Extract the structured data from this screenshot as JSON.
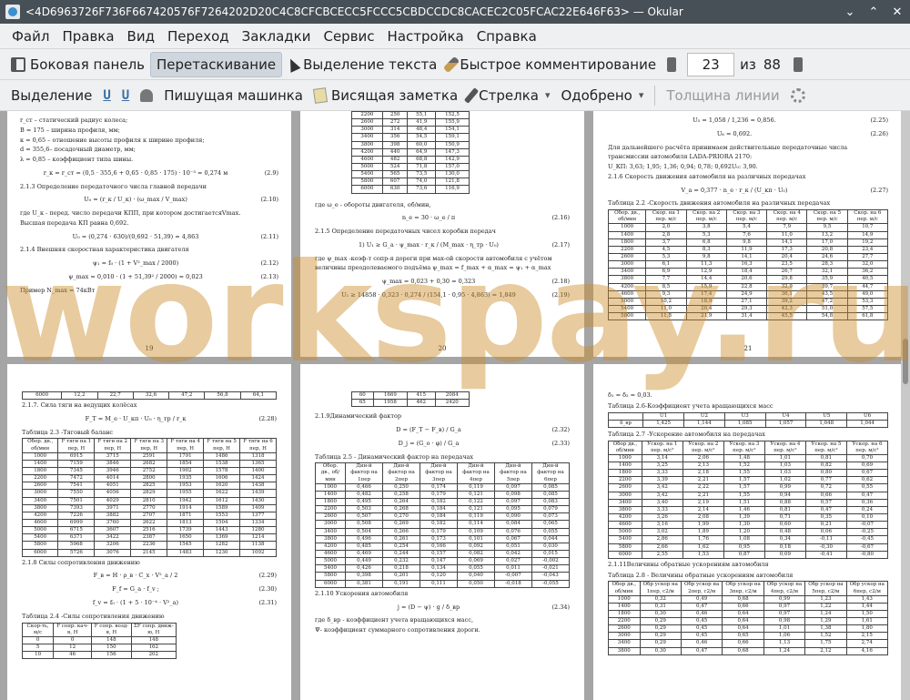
{
  "window": {
    "title": "<4D6963726F736F667420576F7264202D20C4C8CFCBCECC5FCCC5CBDCCDC8CACEC2C05FCAC22E646F63> — Okular",
    "controls": [
      "⌄",
      "⌃",
      "✕"
    ]
  },
  "menubar": [
    "Файл",
    "Правка",
    "Вид",
    "Переход",
    "Закладки",
    "Сервис",
    "Настройка",
    "Справка"
  ],
  "toolbar1": {
    "sidebar": "Боковая панель",
    "drag": "Перетаскивание",
    "select_text": "Выделение текста",
    "quick_comment": "Быстрое комментирование",
    "page_current": "23",
    "page_of": "из",
    "page_total": "88"
  },
  "toolbar2": {
    "highlight": "Выделение",
    "typewriter": "Пишущая машинка",
    "note": "Висящая заметка",
    "arrow": "Стрелка",
    "approved": "Одобрено",
    "line_width": "Толщина линии"
  },
  "watermark": "workspay.ru",
  "pages": {
    "p19": {
      "number": "19",
      "lines": [
        "r_ст – статический радиус колеса;",
        "B = 175 – ширина профиля, мм;",
        "κ = 0,65 – отношение высоты профиля к ширине профиля;",
        "d = 355,6– посадочный диаметр, мм;",
        "λ = 0,85 – коэффициент типа шины."
      ],
      "eq1": "r_к = r_ст = (0,5 · 355,6 + 0,65 · 0,85 · 175) · 10⁻³ = 0,274 м",
      "eq1n": "(2.9)",
      "h213": "2.1.3 Определение передаточного числа главной передачи",
      "eq2": "U₀ = (r_к / U_к) · (ω_max / V_max)",
      "eq2n": "(2.10)",
      "l2": "где U_к - перед. число передачи КПП, при котором достигаетсяVmax.",
      "l3": "Высшая передача КП равна 0,692.",
      "eq3": "U₀ = (0,274 · 630)/(0,692 · 51,39) = 4,863",
      "eq3n": "(2.11)",
      "h214": "2.1.4 Внешняя скоростная характеристика двигателя",
      "eq4": "ψ₁ = f₀ · (1 + V²_max / 2000)",
      "eq4n": "(2.12)",
      "eq5": "ψ_max = 0,010 · (1 + 51,39² / 2000) = 0,023",
      "eq5n": "(2.13)",
      "l4": "Пример  N_max = 74кВт"
    },
    "p20": {
      "number": "20",
      "table": [
        [
          "2200",
          "250",
          "55,1",
          "152,5"
        ],
        [
          "2600",
          "272",
          "41,9",
          "155,9"
        ],
        [
          "3000",
          "314",
          "48,4",
          "154,1"
        ],
        [
          "3400",
          "356",
          "54,5",
          "159,1"
        ],
        [
          "3800",
          "398",
          "60,0",
          "150,9"
        ],
        [
          "4200",
          "440",
          "64,9",
          "147,3"
        ],
        [
          "4600",
          "482",
          "68,8",
          "142,9"
        ],
        [
          "5000",
          "524",
          "71,8",
          "157,0"
        ],
        [
          "5400",
          "565",
          "73,5",
          "130,0"
        ],
        [
          "5800",
          "607",
          "74,0",
          "121,8"
        ],
        [
          "6000",
          "630",
          "73,6",
          "116,9"
        ]
      ],
      "l1": "где ω_e - обороты двигателя, об/мин,",
      "eq1": "n_e = 30 · ω_e / π",
      "eq1n": "(2.16)",
      "h215": "2.1.5 Определение передаточных чисел коробки передач",
      "eq2": "1) U₁ ≥ G_a · ψ_max · r_к / (M_max · η_тр · U₀)",
      "eq2n": "(2.17)",
      "l2": "где ψ_max -коэф-т сопр-я дороги при мах-ой скорости автомобиля  с учётом",
      "l3": "величины преодолеваемого подъёма ψ_max = f_max + α_max = ψ₁ + α_max",
      "eq3": "ψ_max = 0,023 + 0,30 = 0,323",
      "eq3n": "(2.18)",
      "eq4": "U₁ ≥ 14858 · 0,323 · 0,274 / (154,1 · 0,95 · 4,863) = 1,849",
      "eq4n": "(2.19)"
    },
    "p21": {
      "number": "21",
      "eq1": "U₅ = 1,058 / 1,236 = 0,856.",
      "eq1n": "(2.25)",
      "eq2": "U₆ = 0,692.",
      "eq2n": "(2.26)",
      "l1": "Для дальнейшего расчёта принимаем действительные передаточные числа",
      "l2": "трансмиссии автомобиля LADA-PRIORA 2170:",
      "l3": "U_КП: 3,63; 1,95; 1,36; 0,94; 0,78; 0,692U₀: 3,90.",
      "h216": "2.1.6 Скорость движения автомобиля на различных передачах",
      "eq3": "V_a = 0,377 · n_e · r_к / (U_кп · U₀)",
      "eq3n": "(2.27)",
      "cap": "Таблица 2.2 -Скорость движения автомобиля на различных передачах",
      "headers": [
        "Обор. дв., об/мин",
        "Скор. на 1 пер. м/с",
        "Скор. на 2 пер. м/с",
        "Скор. на 3 пер. м/с",
        "Скор. на 4 пер. м/с",
        "Скор. на 5 пер. м/с",
        "Скор. на 6 пер. м/с"
      ],
      "rows": [
        [
          "1000",
          "2,0",
          "3,8",
          "5,4",
          "7,9",
          "9,5",
          "10,7"
        ],
        [
          "1400",
          "2,8",
          "5,3",
          "7,6",
          "11,0",
          "13,2",
          "14,9"
        ],
        [
          "1800",
          "3,7",
          "6,8",
          "9,8",
          "14,1",
          "17,0",
          "19,2"
        ],
        [
          "2200",
          "4,5",
          "8,3",
          "11,9",
          "17,3",
          "20,8",
          "23,4"
        ],
        [
          "2600",
          "5,3",
          "9,8",
          "14,1",
          "20,4",
          "24,6",
          "27,7"
        ],
        [
          "3000",
          "6,1",
          "11,3",
          "16,3",
          "23,5",
          "28,3",
          "32,0"
        ],
        [
          "3400",
          "6,9",
          "12,9",
          "18,4",
          "26,7",
          "32,1",
          "36,2"
        ],
        [
          "3800",
          "7,7",
          "14,4",
          "20,6",
          "29,8",
          "35,9",
          "40,5"
        ],
        [
          "4200",
          "8,5",
          "15,9",
          "22,8",
          "32,9",
          "39,7",
          "44,7"
        ],
        [
          "4600",
          "9,3",
          "17,4",
          "24,9",
          "36,1",
          "43,5",
          "49,0"
        ],
        [
          "5000",
          "10,2",
          "18,9",
          "27,1",
          "39,2",
          "47,2",
          "53,3"
        ],
        [
          "5400",
          "11,0",
          "20,4",
          "29,3",
          "42,3",
          "51,0",
          "57,5"
        ],
        [
          "5800",
          "11,8",
          "21,9",
          "31,4",
          "45,5",
          "54,8",
          "61,8"
        ]
      ]
    },
    "p22": {
      "first_row": [
        "6000",
        "12,2",
        "22,7",
        "32,6",
        "47,2",
        "56,8",
        "64,1"
      ],
      "h217": "2.1.7. Сила тяги на ведущих колёсах",
      "eq1": "F_T = M_e · U_кп · U₀ · η_тр / r_к",
      "eq1n": "(2.28)",
      "cap": "Таблица 2.3 -Тяговый баланс",
      "headers": [
        "Обор. дв., об/мин",
        "F тяги на 1 пер, Н",
        "F тяги на 2 пер, Н",
        "F тяги на 3 пер, Н",
        "F тяги на 4 пер, Н",
        "F тяги на 5 пер, Н",
        "F тяги на 6 пер, Н"
      ],
      "rows": [
        [
          "1000",
          "6915",
          "3715",
          "2591",
          "1791",
          "1486",
          "1318"
        ],
        [
          "1400",
          "7159",
          "3846",
          "2682",
          "1854",
          "1538",
          "1365"
        ],
        [
          "1800",
          "7345",
          "3946",
          "2752",
          "1902",
          "1578",
          "1400"
        ],
        [
          "2200",
          "7472",
          "4014",
          "2800",
          "1935",
          "1606",
          "1424"
        ],
        [
          "2600",
          "7541",
          "4051",
          "2825",
          "1953",
          "1620",
          "1438"
        ],
        [
          "3000",
          "7550",
          "4056",
          "2829",
          "1955",
          "1622",
          "1439"
        ],
        [
          "3400",
          "7501",
          "4029",
          "2810",
          "1942",
          "1612",
          "1430"
        ],
        [
          "3800",
          "7393",
          "3971",
          "2770",
          "1914",
          "1589",
          "1409"
        ],
        [
          "4200",
          "7226",
          "3882",
          "2707",
          "1871",
          "1553",
          "1377"
        ],
        [
          "4600",
          "6999",
          "3760",
          "2622",
          "1813",
          "1504",
          "1334"
        ],
        [
          "5000",
          "6715",
          "3607",
          "2516",
          "1739",
          "1443",
          "1280"
        ],
        [
          "5400",
          "6371",
          "3422",
          "2387",
          "1650",
          "1369",
          "1214"
        ],
        [
          "5800",
          "5968",
          "3206",
          "2236",
          "1545",
          "1282",
          "1138"
        ],
        [
          "6000",
          "5726",
          "3076",
          "2145",
          "1483",
          "1230",
          "1092"
        ]
      ],
      "h218": "2.1.8 Силы сопротивления движению",
      "eq2": "F_в = H · ρ_в · C_x · V²_a / 2",
      "eq2n": "(2.29)",
      "eq3": "F_f = G_a · f_v ;",
      "eq3n": "(2.30)",
      "eq4": "f_v = f₀ · (1 + 5 · 10⁻⁴ · V²_a)",
      "eq4n": "(2.31)",
      "cap2": "Таблица 2.4 -Силы сопротивления движению",
      "headers2": [
        "Скор-ть, м/с",
        "F сопр. кач-я, Н",
        "F сопр. возд-я, Н",
        "ΣF сопр. движ-ю, Н"
      ],
      "rows2": [
        [
          "0",
          "0",
          "148",
          "148"
        ],
        [
          "5",
          "12",
          "150",
          "162"
        ],
        [
          "10",
          "46",
          "156",
          "202"
        ]
      ]
    },
    "p23": {
      "rows": [
        [
          "60",
          "1669",
          "415",
          "2084"
        ],
        [
          "65",
          "1958",
          "462",
          "2420"
        ]
      ],
      "h219": "2.1.9Динамический фактор",
      "eq1": "D = (F_T − F_в) / G_a",
      "eq1n": "(2.32)",
      "eq2": "D_j = (G_o · φ) / G_a",
      "eq2n": "(2.33)",
      "cap": "Таблица 2.5 - Динамический фактор на передачах",
      "headers": [
        "Обор. дв., об/мин",
        "Дин-й фактор на 1пер",
        "Дин-й фактор на 2пер",
        "Дин-й фактор на 3пер",
        "Дин-й фактор на 4пер",
        "Дин-й фактор на 5пер",
        "Дин-й фактор на 6пер"
      ],
      "drows": [
        [
          "1000",
          "0,466",
          "0,250",
          "0,174",
          "0,119",
          "0,097",
          "0,085"
        ],
        [
          "1400",
          "0,482",
          "0,258",
          "0,179",
          "0,121",
          "0,098",
          "0,085"
        ],
        [
          "1800",
          "0,495",
          "0,264",
          "0,182",
          "0,122",
          "0,097",
          "0,083"
        ],
        [
          "2200",
          "0,503",
          "0,268",
          "0,184",
          "0,121",
          "0,095",
          "0,079"
        ],
        [
          "2600",
          "0,507",
          "0,270",
          "0,184",
          "0,119",
          "0,090",
          "0,073"
        ],
        [
          "3000",
          "0,508",
          "0,269",
          "0,182",
          "0,114",
          "0,084",
          "0,065"
        ],
        [
          "3400",
          "0,504",
          "0,266",
          "0,179",
          "0,109",
          "0,076",
          "0,055"
        ],
        [
          "3800",
          "0,496",
          "0,261",
          "0,173",
          "0,101",
          "0,067",
          "0,044"
        ],
        [
          "4200",
          "0,485",
          "0,254",
          "0,166",
          "0,092",
          "0,051",
          "0,030"
        ],
        [
          "4600",
          "0,469",
          "0,244",
          "0,157",
          "0,082",
          "0,042",
          "0,015"
        ],
        [
          "5000",
          "0,449",
          "0,232",
          "0,147",
          "0,069",
          "0,027",
          "-0,002"
        ],
        [
          "5400",
          "0,426",
          "0,218",
          "0,134",
          "0,055",
          "0,011",
          "-0,021"
        ],
        [
          "5800",
          "0,398",
          "0,201",
          "0,120",
          "0,040",
          "-0,007",
          "-0,043"
        ],
        [
          "6000",
          "0,381",
          "0,191",
          "0,111",
          "0,050",
          "-0,018",
          "-0,055"
        ]
      ],
      "h2110": "2.1.10 Ускорения автомобиля",
      "eq3": "j = (D − ψ) · g / δ_вр",
      "eq3n": "(2.34)",
      "l1": "где δ_вр - коэффициент  учета вращающихся масс,",
      "l2": "Ψ- коэффициент суммарного сопротивления дороги."
    },
    "p24": {
      "l1": "δ₁ = δ₂ = 0,03.",
      "cap1": "Таблица 2.6-Коэффициент  учета вращающихся масс",
      "kheaders": [
        "",
        "U1",
        "U2",
        "U3",
        "U4",
        "U5",
        "U6"
      ],
      "krow": [
        "δ_вр",
        "1,425",
        "1,144",
        "1,085",
        "1,057",
        "1,048",
        "1,044"
      ],
      "cap2": "Таблица 2.7 -Ускорение автомобиля на передачах",
      "aheaders": [
        "Обор дв., об/мин",
        "Ускор. на 1 пер. м/с²",
        "Ускор. на 2 пер. м/с²",
        "Ускор. на 3 пер. м/с²",
        "Ускор. на 4 пер. м/с²",
        "Ускор. на 5 пер. м/с²",
        "Ускор. на 6 пер. м/с²"
      ],
      "arows": [
        [
          "1000",
          "3,14",
          "2,06",
          "1,48",
          "1,01",
          "0,81",
          "0,70"
        ],
        [
          "1400",
          "3,25",
          "2,13",
          "1,52",
          "1,03",
          "0,82",
          "0,69"
        ],
        [
          "1800",
          "3,33",
          "2,18",
          "1,55",
          "1,03",
          "0,80",
          "0,67"
        ],
        [
          "2200",
          "3,39",
          "2,21",
          "1,57",
          "1,02",
          "0,77",
          "0,62"
        ],
        [
          "2600",
          "3,42",
          "2,22",
          "1,57",
          "0,99",
          "0,72",
          "0,55"
        ],
        [
          "3000",
          "3,42",
          "2,21",
          "1,55",
          "0,94",
          "0,66",
          "0,47"
        ],
        [
          "3400",
          "3,40",
          "2,19",
          "1,51",
          "0,88",
          "0,57",
          "0,36"
        ],
        [
          "3800",
          "3,33",
          "2,14",
          "1,46",
          "0,81",
          "0,47",
          "0,24"
        ],
        [
          "4200",
          "3,26",
          "2,08",
          "1,39",
          "0,71",
          "0,35",
          "0,10"
        ],
        [
          "4600",
          "3,16",
          "1,99",
          "1,30",
          "0,60",
          "0,21",
          "-0,07"
        ],
        [
          "5000",
          "3,02",
          "1,89",
          "1,20",
          "0,48",
          "0,06",
          "-0,25"
        ],
        [
          "5400",
          "2,86",
          "1,76",
          "1,08",
          "0,34",
          "-0,11",
          "-0,45"
        ],
        [
          "5800",
          "2,66",
          "1,62",
          "0,95",
          "0,18",
          "-0,30",
          "-0,67"
        ],
        [
          "6000",
          "2,55",
          "1,53",
          "0,87",
          "0,09",
          "-0,41",
          "-0,80"
        ]
      ],
      "h2111": "2.1.11Величины обратные ускорениям автомобиля",
      "cap3": "Таблица 2.8 - Величины обратные ускорениям автомобиля",
      "rheaders": [
        "Обор дв., об/мин",
        "Обр ускор на 1пер, с2/м",
        "Обр ускор на 2пер, с2/м",
        "Обр ускор на 3пер, с2/м",
        "Обр ускор на 4пер, с2/м",
        "Обр ускор на 5пер, с2/м",
        "Обр ускор на 6пер, с2/м"
      ],
      "rrows": [
        [
          "1000",
          "0,32",
          "0,49",
          "0,68",
          "0,99",
          "1,23",
          "1,43"
        ],
        [
          "1400",
          "0,31",
          "0,47",
          "0,66",
          "0,97",
          "1,22",
          "1,44"
        ],
        [
          "1800",
          "0,30",
          "0,46",
          "0,64",
          "0,97",
          "1,24",
          "1,50"
        ],
        [
          "2200",
          "0,29",
          "0,45",
          "0,64",
          "0,98",
          "1,29",
          "1,61"
        ],
        [
          "2600",
          "0,29",
          "0,45",
          "0,64",
          "1,01",
          "1,38",
          "1,80"
        ],
        [
          "3000",
          "0,29",
          "0,45",
          "0,65",
          "1,06",
          "1,52",
          "2,15"
        ],
        [
          "3400",
          "0,29",
          "0,46",
          "0,66",
          "1,13",
          "1,75",
          "2,74"
        ],
        [
          "3800",
          "0,30",
          "0,47",
          "0,68",
          "1,24",
          "2,12",
          "4,16"
        ]
      ]
    }
  }
}
